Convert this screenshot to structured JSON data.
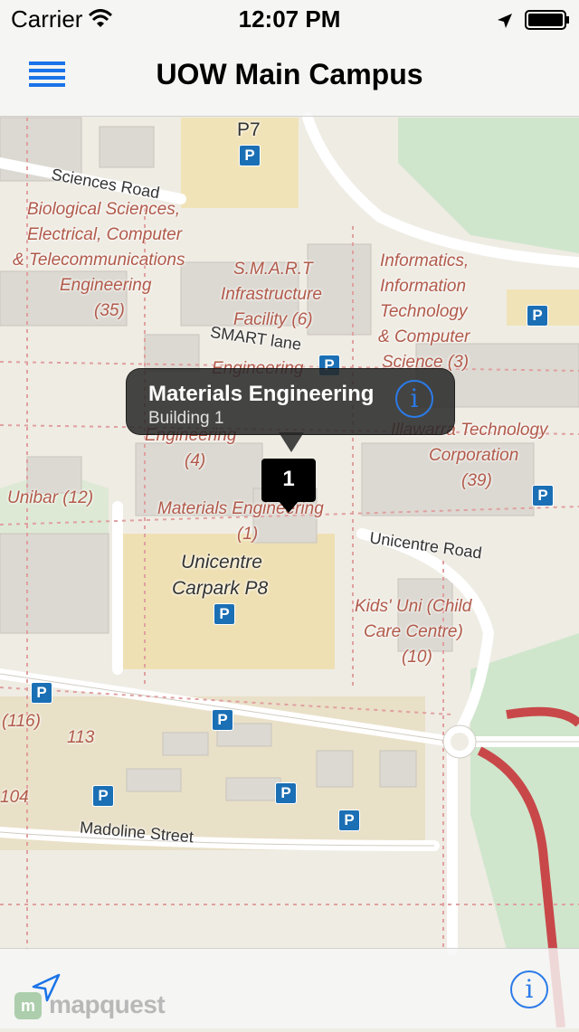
{
  "status": {
    "carrier": "Carrier",
    "time": "12:07 PM"
  },
  "nav": {
    "title": "UOW Main Campus",
    "menu_icon": "hamburger-icon"
  },
  "map": {
    "road_labels": {
      "sciences_road": "Sciences Road",
      "smart_lane": "SMART lane",
      "unicentre_road": "Unicentre Road",
      "madoline_street": "Madoline Street"
    },
    "labels": {
      "bio": "Biological Sciences,",
      "bio2": "Electrical, Computer",
      "bio3": "& Telecommunications",
      "bio4": "Engineering",
      "bio5": "(35)",
      "smart": "S.M.A.R.T",
      "smart2": "Infrastructure",
      "smart3": "Facility (6)",
      "info": "Informatics,",
      "info2": "Information",
      "info3": "Technology",
      "info4": "& Computer",
      "info5": "Science (3)",
      "eng_top": "Engineering",
      "eng_mid": "Engineering",
      "eng_mid2": "(4)",
      "itc": "Illawarra Technology",
      "itc2": "Corporation",
      "itc3": "(39)",
      "unibar": "Unibar (12)",
      "mat": "Materials Engineering",
      "mat2": "(1)",
      "carpark": "Unicentre",
      "carpark2": "Carpark P8",
      "kids": "Kids' Uni (Child",
      "kids2": "Care Centre)",
      "kids3": "(10)",
      "p7": "P7",
      "n116": "(116)",
      "n113": "113",
      "n104": "104"
    },
    "parking_glyph": "P"
  },
  "callout": {
    "title": "Materials Engineering",
    "subtitle": "Building 1",
    "info_glyph": "i"
  },
  "pin": {
    "label": "1"
  },
  "toolbar": {
    "info_glyph": "i",
    "logo_badge": "m",
    "logo_text": "mapquest"
  }
}
